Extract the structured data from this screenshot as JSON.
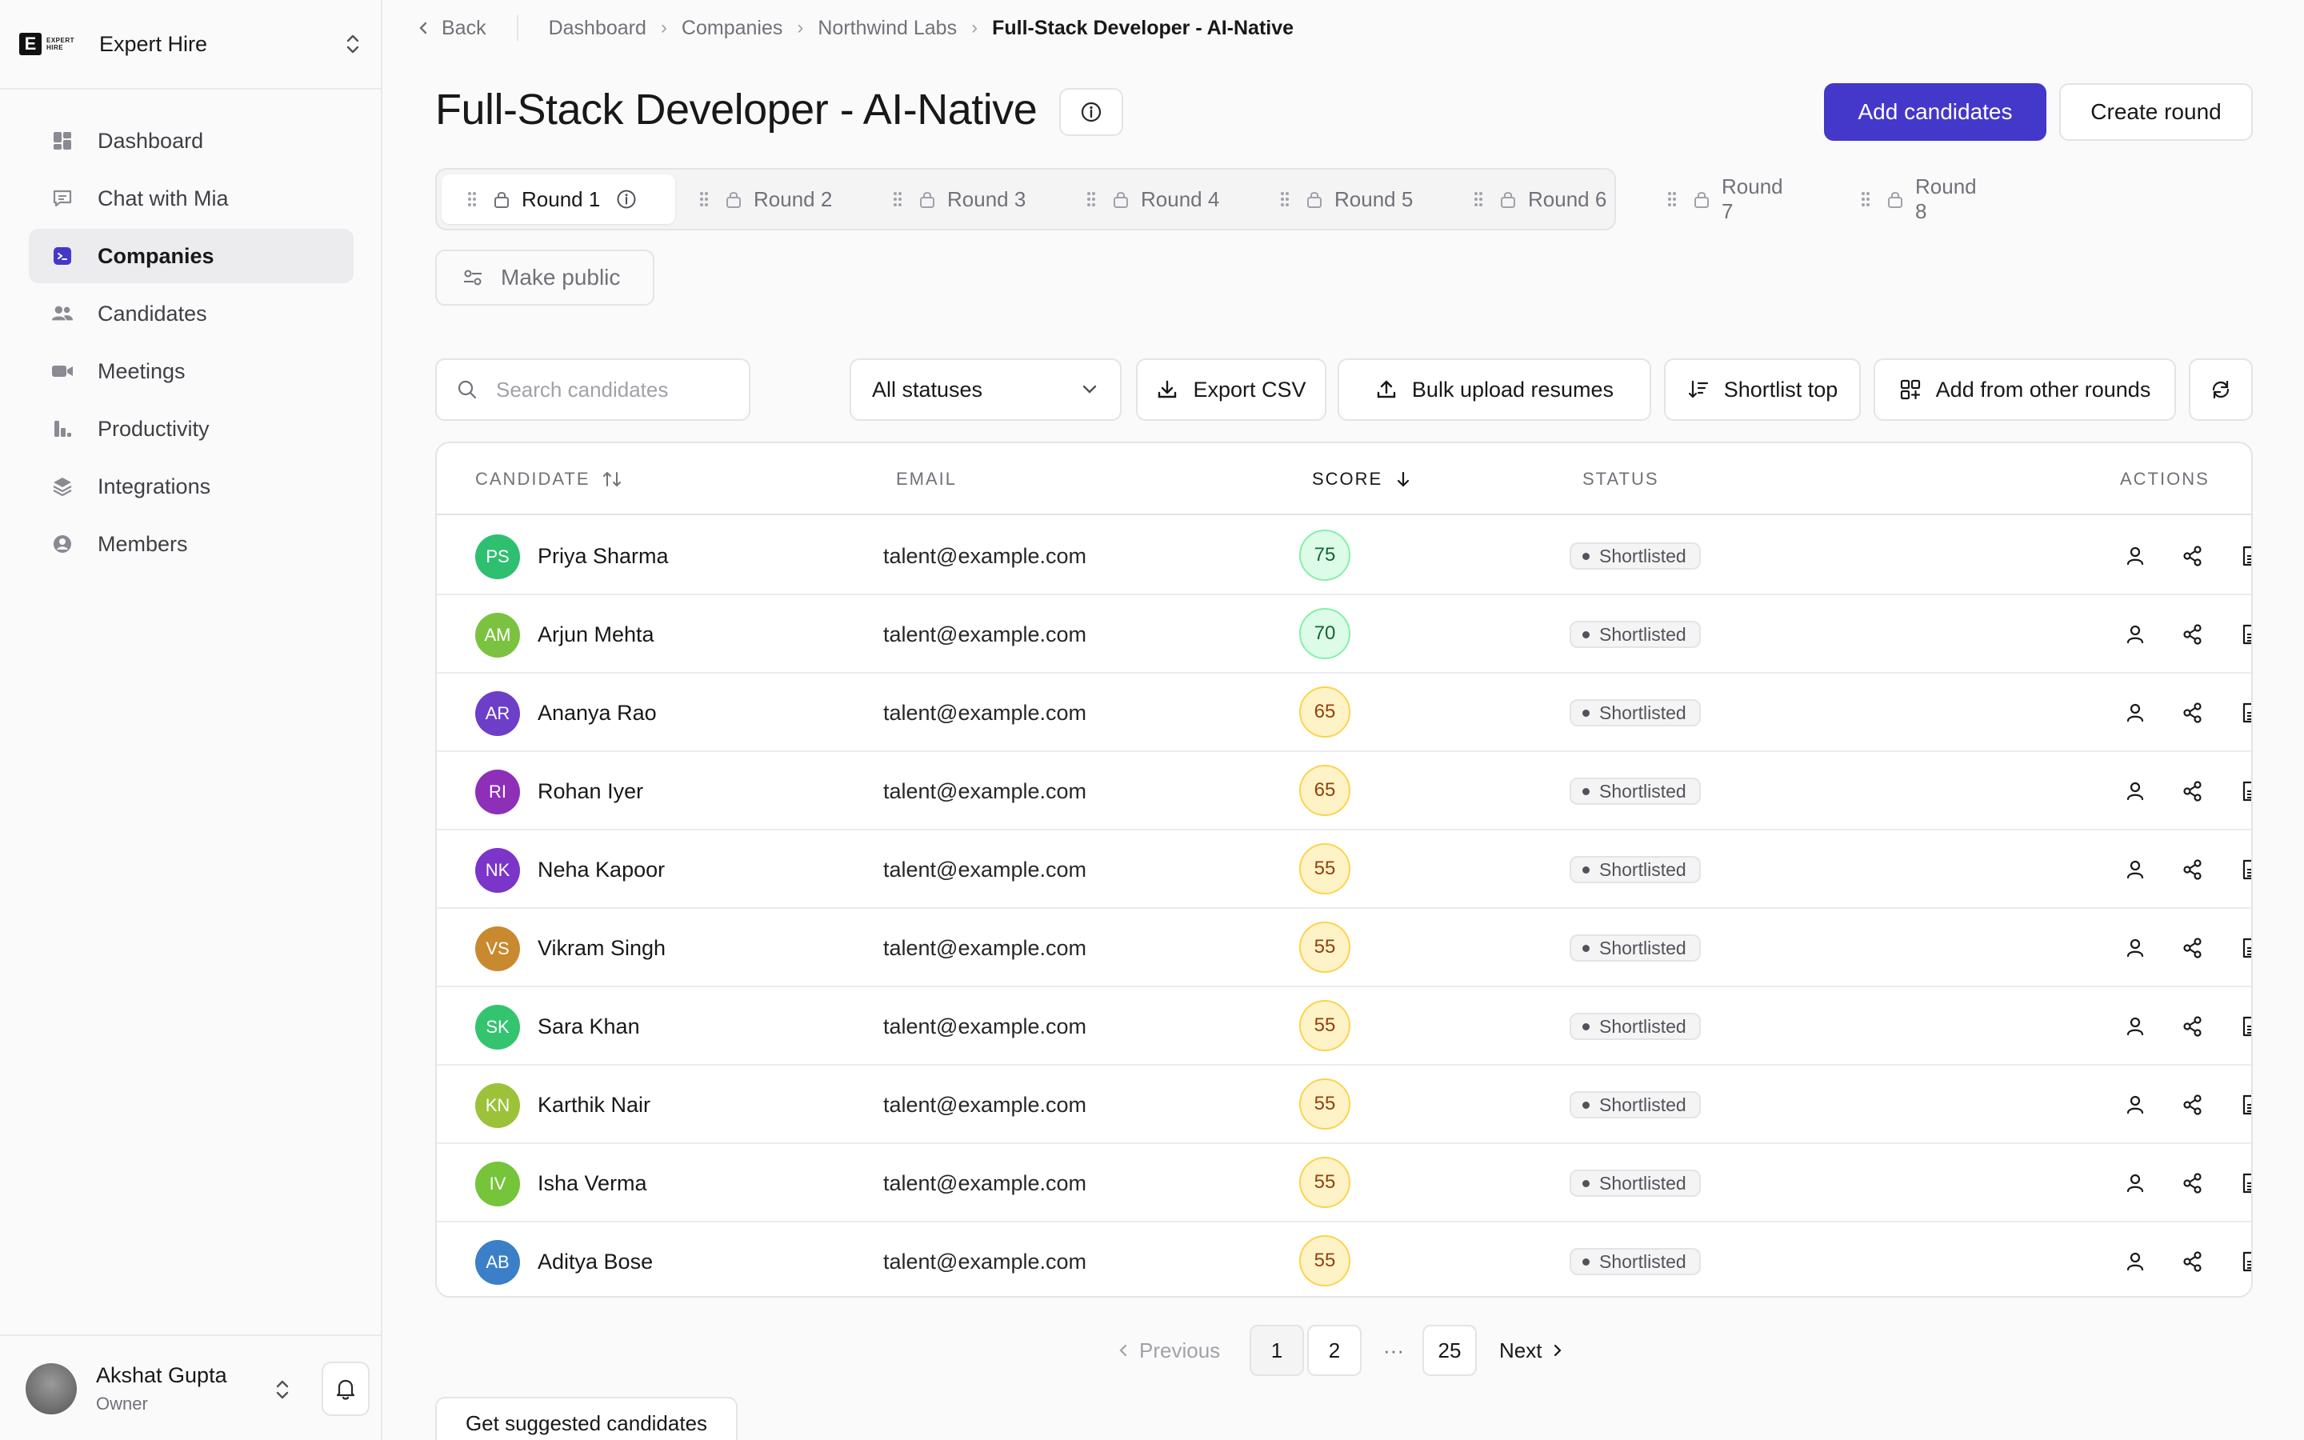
{
  "brand": {
    "logo_text": "E",
    "logo_small_1": "EXPERT",
    "logo_small_2": "HIRE",
    "name": "Expert Hire"
  },
  "sidebar": {
    "items": [
      {
        "label": "Dashboard",
        "icon": "dashboard-icon"
      },
      {
        "label": "Chat with Mia",
        "icon": "chat-icon"
      },
      {
        "label": "Companies",
        "icon": "terminal-icon",
        "active": true
      },
      {
        "label": "Candidates",
        "icon": "users-icon"
      },
      {
        "label": "Meetings",
        "icon": "video-icon"
      },
      {
        "label": "Productivity",
        "icon": "chart-icon"
      },
      {
        "label": "Integrations",
        "icon": "layers-icon"
      },
      {
        "label": "Members",
        "icon": "user-circle-icon"
      }
    ]
  },
  "user": {
    "name": "Akshat Gupta",
    "role": "Owner"
  },
  "breadcrumb": {
    "back": "Back",
    "items": [
      "Dashboard",
      "Companies",
      "Northwind Labs"
    ],
    "current": "Full-Stack Developer - AI-Native"
  },
  "page": {
    "title": "Full-Stack Developer - AI-Native",
    "add_candidates": "Add candidates",
    "create_round": "Create round"
  },
  "rounds": [
    "Round 1",
    "Round 2",
    "Round 3",
    "Round 4",
    "Round 5",
    "Round 6",
    "Round 7",
    "Round 8"
  ],
  "make_public": "Make public",
  "toolbar": {
    "search_placeholder": "Search candidates",
    "status_filter": "All statuses",
    "export": "Export CSV",
    "bulk_upload": "Bulk upload resumes",
    "shortlist_top": "Shortlist top",
    "add_from_rounds": "Add from other rounds"
  },
  "table": {
    "headers": {
      "candidate": "CANDIDATE",
      "email": "EMAIL",
      "score": "SCORE",
      "status": "STATUS",
      "actions": "ACTIONS"
    },
    "rows": [
      {
        "initials": "PS",
        "name": "Priya Sharma",
        "email": "talent@example.com",
        "score": "75",
        "tone": "green",
        "status": "Shortlisted",
        "color": "#2fbf71"
      },
      {
        "initials": "AM",
        "name": "Arjun Mehta",
        "email": "talent@example.com",
        "score": "70",
        "tone": "green",
        "status": "Shortlisted",
        "color": "#7cc241"
      },
      {
        "initials": "AR",
        "name": "Ananya Rao",
        "email": "talent@example.com",
        "score": "65",
        "tone": "yellow",
        "status": "Shortlisted",
        "color": "#6d3fc8"
      },
      {
        "initials": "RI",
        "name": "Rohan Iyer",
        "email": "talent@example.com",
        "score": "65",
        "tone": "yellow",
        "status": "Shortlisted",
        "color": "#8e2fb8"
      },
      {
        "initials": "NK",
        "name": "Neha Kapoor",
        "email": "talent@example.com",
        "score": "55",
        "tone": "yellow",
        "status": "Shortlisted",
        "color": "#7b35c9"
      },
      {
        "initials": "VS",
        "name": "Vikram Singh",
        "email": "talent@example.com",
        "score": "55",
        "tone": "yellow",
        "status": "Shortlisted",
        "color": "#c9892f"
      },
      {
        "initials": "SK",
        "name": "Sara Khan",
        "email": "talent@example.com",
        "score": "55",
        "tone": "yellow",
        "status": "Shortlisted",
        "color": "#34c470"
      },
      {
        "initials": "KN",
        "name": "Karthik Nair",
        "email": "talent@example.com",
        "score": "55",
        "tone": "yellow",
        "status": "Shortlisted",
        "color": "#9cc23a"
      },
      {
        "initials": "IV",
        "name": "Isha Verma",
        "email": "talent@example.com",
        "score": "55",
        "tone": "yellow",
        "status": "Shortlisted",
        "color": "#76c43a"
      },
      {
        "initials": "AB",
        "name": "Aditya Bose",
        "email": "talent@example.com",
        "score": "55",
        "tone": "yellow",
        "status": "Shortlisted",
        "color": "#3b7fc8"
      }
    ]
  },
  "pagination": {
    "previous": "Previous",
    "pages": [
      "1",
      "2"
    ],
    "ellipsis": "···",
    "last": "25",
    "next": "Next"
  },
  "suggest": "Get suggested candidates"
}
